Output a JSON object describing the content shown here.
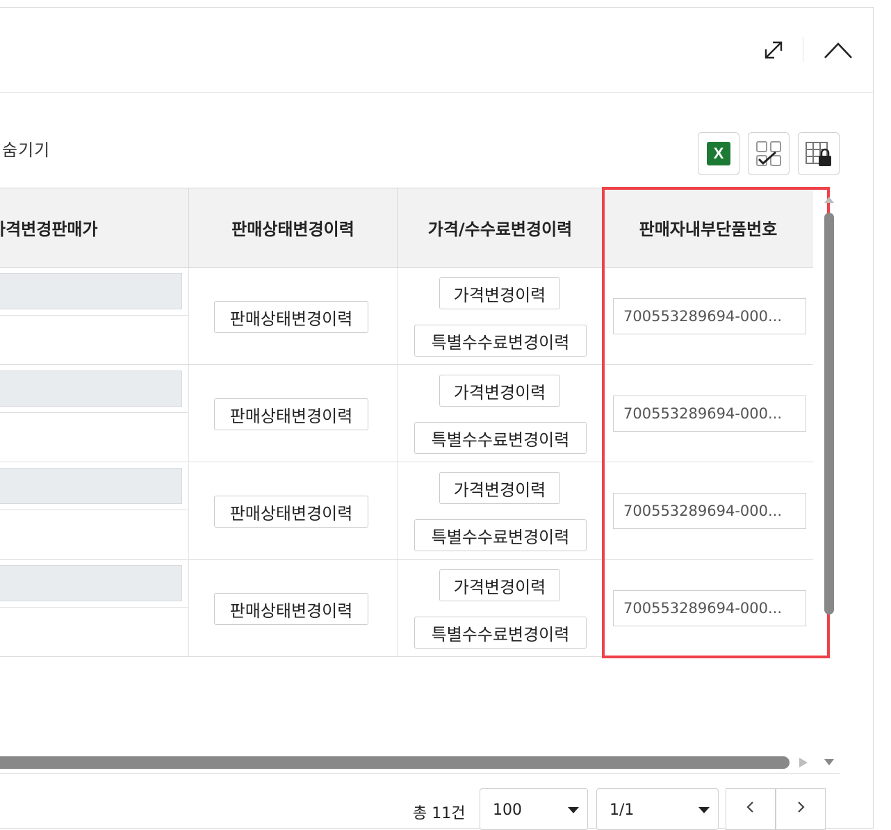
{
  "toolbar": {
    "hide_label": "숨기기",
    "excel_label": "X"
  },
  "columns": [
    {
      "label": "가격변경판매가"
    },
    {
      "label": "판매상태변경이력"
    },
    {
      "label": "가격/수수료변경이력"
    },
    {
      "label": "판매자내부단품번호"
    }
  ],
  "rows": [
    {
      "status_btn": "판매상태변경이력",
      "price_btn": "가격변경이력",
      "fee_btn": "특별수수료변경이력",
      "item_no": "700553289694-000..."
    },
    {
      "status_btn": "판매상태변경이력",
      "price_btn": "가격변경이력",
      "fee_btn": "특별수수료변경이력",
      "item_no": "700553289694-000..."
    },
    {
      "status_btn": "판매상태변경이력",
      "price_btn": "가격변경이력",
      "fee_btn": "특별수수료변경이력",
      "item_no": "700553289694-000..."
    },
    {
      "status_btn": "판매상태변경이력",
      "price_btn": "가격변경이력",
      "fee_btn": "특별수수료변경이력",
      "item_no": "700553289694-000..."
    }
  ],
  "footer": {
    "total": "총 11건",
    "page_size": "100",
    "page": "1/1"
  },
  "colors": {
    "highlight": "#ee4148",
    "excel": "#1d7a34",
    "header_bg": "#f2f2f2"
  },
  "icons": [
    "expand-icon",
    "collapse-chevron-icon",
    "excel-icon",
    "column-select-icon",
    "column-lock-icon",
    "prev-page-icon",
    "next-page-icon"
  ]
}
